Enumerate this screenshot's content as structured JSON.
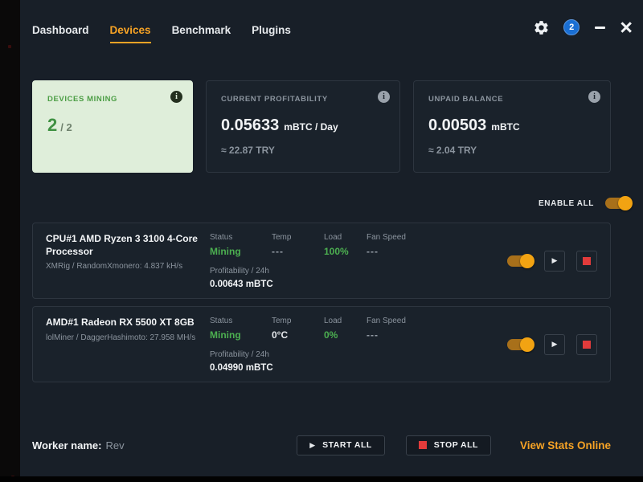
{
  "nav": {
    "items": [
      {
        "label": "Dashboard"
      },
      {
        "label": "Devices"
      },
      {
        "label": "Benchmark"
      },
      {
        "label": "Plugins"
      }
    ],
    "notification_count": "2"
  },
  "stats": {
    "devices_mining": {
      "label": "DEVICES MINING",
      "value": "2",
      "total": "/ 2"
    },
    "profitability": {
      "label": "CURRENT PROFITABILITY",
      "value": "0.05633",
      "unit": "mBTC / Day",
      "fiat": "≈ 22.87 TRY"
    },
    "balance": {
      "label": "UNPAID BALANCE",
      "value": "0.00503",
      "unit": "mBTC",
      "fiat": "≈ 2.04 TRY"
    }
  },
  "controls": {
    "enable_all": "ENABLE ALL"
  },
  "device_columns": {
    "status": "Status",
    "temp": "Temp",
    "load": "Load",
    "fan": "Fan Speed",
    "profit": "Profitability / 24h"
  },
  "devices": [
    {
      "name": "CPU#1 AMD Ryzen 3 3100 4-Core Processor",
      "miner": "XMRig / RandomXmonero: 4.837 kH/s",
      "status": "Mining",
      "temp": "---",
      "load": "100%",
      "fan": "---",
      "profit": "0.00643 mBTC"
    },
    {
      "name": "AMD#1 Radeon RX 5500 XT 8GB",
      "miner": "lolMiner / DaggerHashimoto: 27.958 MH/s",
      "status": "Mining",
      "temp": "0°C",
      "load": "0%",
      "fan": "---",
      "profit": "0.04990 mBTC"
    }
  ],
  "footer": {
    "worker_label": "Worker name:",
    "worker_value": "Rev",
    "start_all": "START ALL",
    "stop_all": "STOP ALL",
    "view_stats": "View Stats Online"
  },
  "icons": {
    "gear": "settings",
    "info": "i",
    "play": "▶",
    "stop": "square",
    "minimize": "bar",
    "close": "×"
  },
  "colors": {
    "accent_orange": "#f7a325",
    "mining_green": "#4caf50",
    "card_green_bg": "#dfeeda",
    "badge_blue": "#1a6fd4",
    "stop_red": "#e23b3b",
    "window_bg": "#181f28"
  }
}
